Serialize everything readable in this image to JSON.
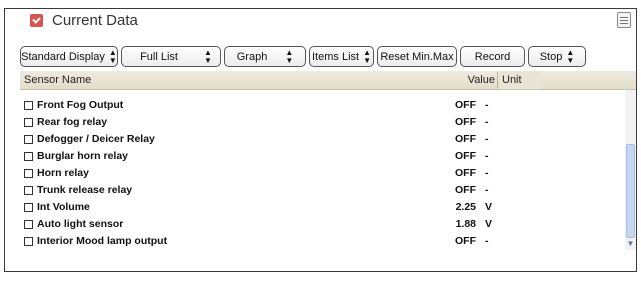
{
  "window": {
    "title": "Current Data"
  },
  "toolbar": {
    "standard_display": "Standard Display",
    "full_list": "Full List",
    "graph": "Graph",
    "items_list": "Items List",
    "reset_minmax": "Reset Min.Max",
    "record": "Record",
    "stop": "Stop"
  },
  "table": {
    "headers": {
      "name": "Sensor Name",
      "value": "Value",
      "unit": "Unit"
    },
    "rows": [
      {
        "name": "Front Fog Output",
        "value": "OFF",
        "unit": "-"
      },
      {
        "name": "Rear fog relay",
        "value": "OFF",
        "unit": "-"
      },
      {
        "name": "Defogger / Deicer Relay",
        "value": "OFF",
        "unit": "-"
      },
      {
        "name": "Burglar horn relay",
        "value": "OFF",
        "unit": "-"
      },
      {
        "name": "Horn relay",
        "value": "OFF",
        "unit": "-"
      },
      {
        "name": "Trunk release relay",
        "value": "OFF",
        "unit": "-"
      },
      {
        "name": "Int Volume",
        "value": "2.25",
        "unit": "V"
      },
      {
        "name": "Auto light sensor",
        "value": "1.88",
        "unit": "V"
      },
      {
        "name": "Interior Mood lamp output",
        "value": "OFF",
        "unit": "-"
      }
    ]
  },
  "icons": {
    "title_icon": "red-check-icon",
    "menu_icon": "list-menu-icon",
    "dropdown": "up-down-arrows-icon"
  },
  "colors": {
    "title_icon": "#d9534f",
    "header_bg": "#e6e0cd",
    "scroll_thumb": "#c7d7f0"
  }
}
